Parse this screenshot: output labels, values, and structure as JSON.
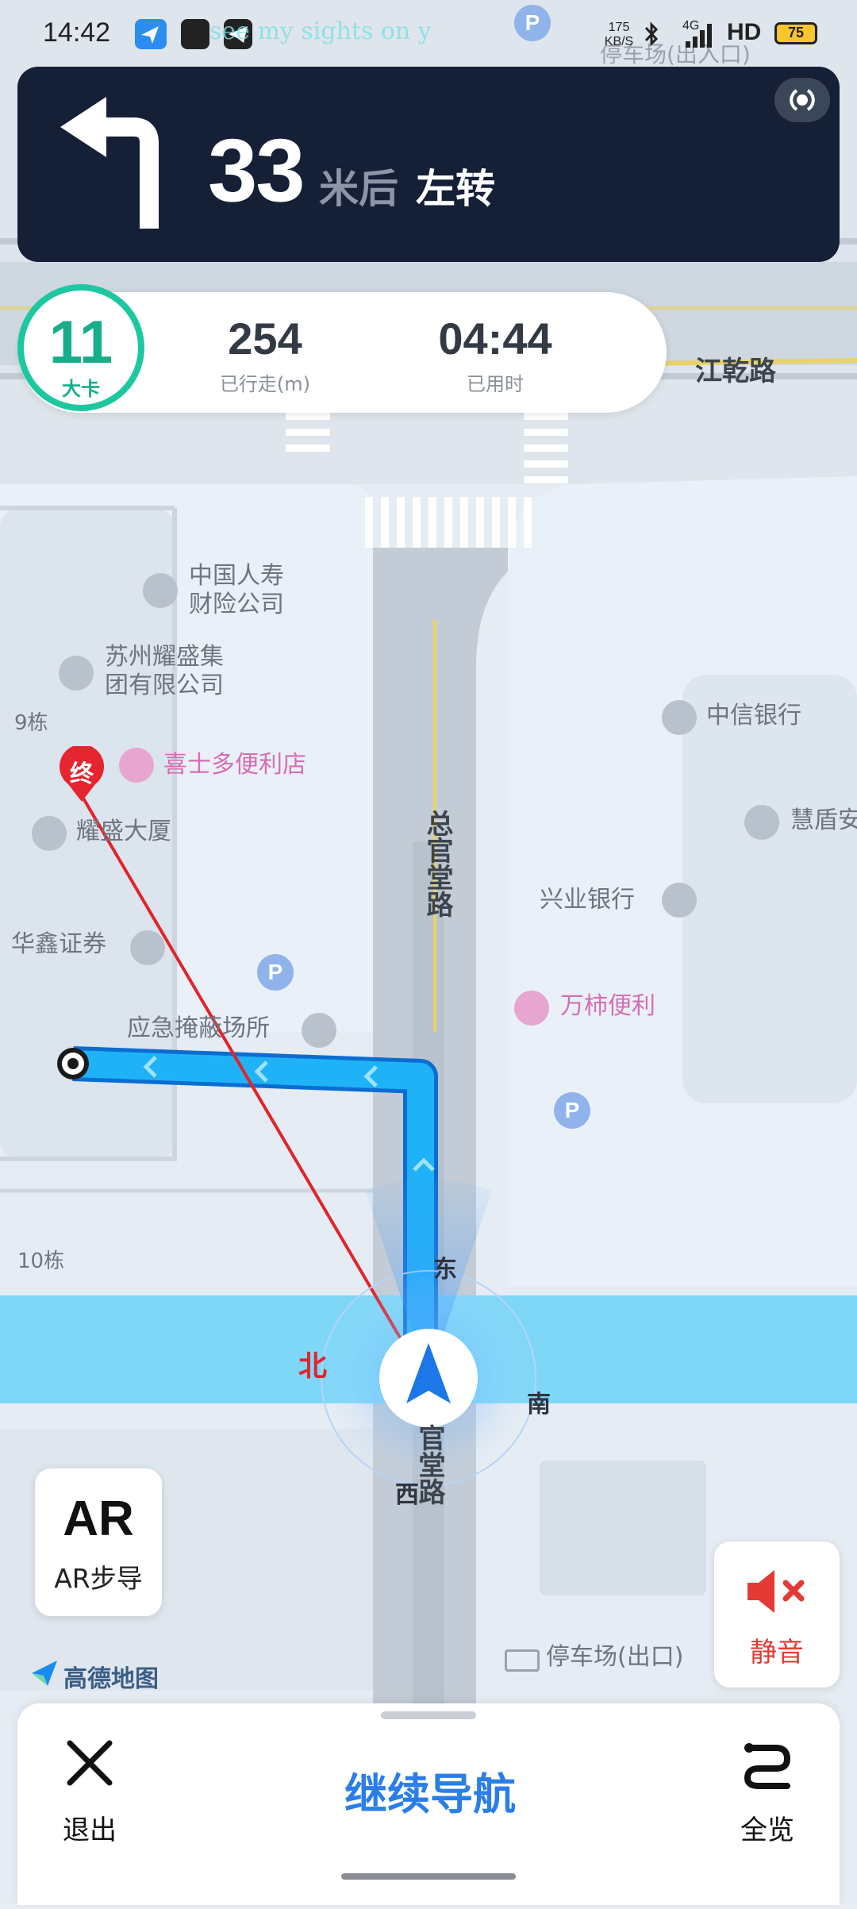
{
  "status_bar": {
    "time": "14:42",
    "net_speed": "175 KB/S",
    "network": "4G",
    "hd": "HD",
    "battery": "75",
    "overlay_text": "see my sights on y"
  },
  "navigation": {
    "distance": "33",
    "unit": "米后",
    "action": "左转",
    "turn_icon": "turn-left-arrow-icon"
  },
  "trip": {
    "speed_value": "11",
    "speed_unit": "大卡",
    "traveled_value": "254",
    "traveled_label": "已行走(m)",
    "time_value": "04:44",
    "time_label": "已用时"
  },
  "map": {
    "pois": [
      {
        "name": "中国人寿\n财险公司"
      },
      {
        "name": "苏州耀盛集\n团有限公司"
      },
      {
        "name": "9栋"
      },
      {
        "name": "喜士多便利店"
      },
      {
        "name": "耀盛大厦"
      },
      {
        "name": "华鑫证券"
      },
      {
        "name": "应急掩蔽场所"
      },
      {
        "name": "中信银行"
      },
      {
        "name": "慧盾安"
      },
      {
        "name": "兴业银行"
      },
      {
        "name": "万柿便利"
      },
      {
        "name": "10栋"
      },
      {
        "name": "停车场(出入口)"
      },
      {
        "name": "停车场(出口)"
      }
    ],
    "roads": [
      {
        "name": "江乾路"
      },
      {
        "name": "总官堂路"
      },
      {
        "name": "官堂路"
      }
    ],
    "compass": {
      "north": "北",
      "east": "东",
      "south": "南",
      "west": "西"
    },
    "destination_marker": "终"
  },
  "buttons": {
    "ar_title": "AR",
    "ar_label": "AR步导",
    "mute_label": "静音",
    "exit_label": "退出",
    "continue_label": "继续导航",
    "overview_label": "全览"
  },
  "logo": {
    "text": "高德地图"
  },
  "colors": {
    "route": "#1ea6f5",
    "card_bg": "#152036",
    "accent_blue": "#2a7ee8",
    "speed_green": "#1dc8a0",
    "mute_red": "#e53935",
    "destination_red": "#e5252f"
  }
}
